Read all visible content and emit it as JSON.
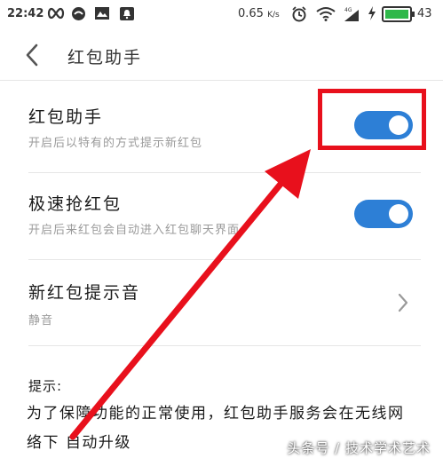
{
  "status_bar": {
    "time": "22:42",
    "speed": "0.65",
    "speed_unit": "K/s",
    "network": "4G",
    "battery": "43"
  },
  "header": {
    "title": "红包助手"
  },
  "settings": {
    "red_packet_assistant": {
      "title": "红包助手",
      "subtitle": "开启后以特有的方式提示新红包",
      "enabled": true
    },
    "fast_grab": {
      "title": "极速抢红包",
      "subtitle": "开启后来红包会自动进入红包聊天界面",
      "enabled": true
    },
    "new_packet_sound": {
      "title": "新红包提示音",
      "value": "静音"
    }
  },
  "tip": {
    "label": "提示:",
    "text": "为了保障功能的正常使用，红包助手服务会在无线网络下 自动升级"
  },
  "watermark": "头条号 / 技术学术艺术",
  "colors": {
    "toggle_on": "#2d7fd6",
    "highlight": "#e8101c",
    "battery_green": "#2fb84a"
  },
  "icons": {
    "back": "chevron-left-icon",
    "chevron": "chevron-right-icon"
  }
}
